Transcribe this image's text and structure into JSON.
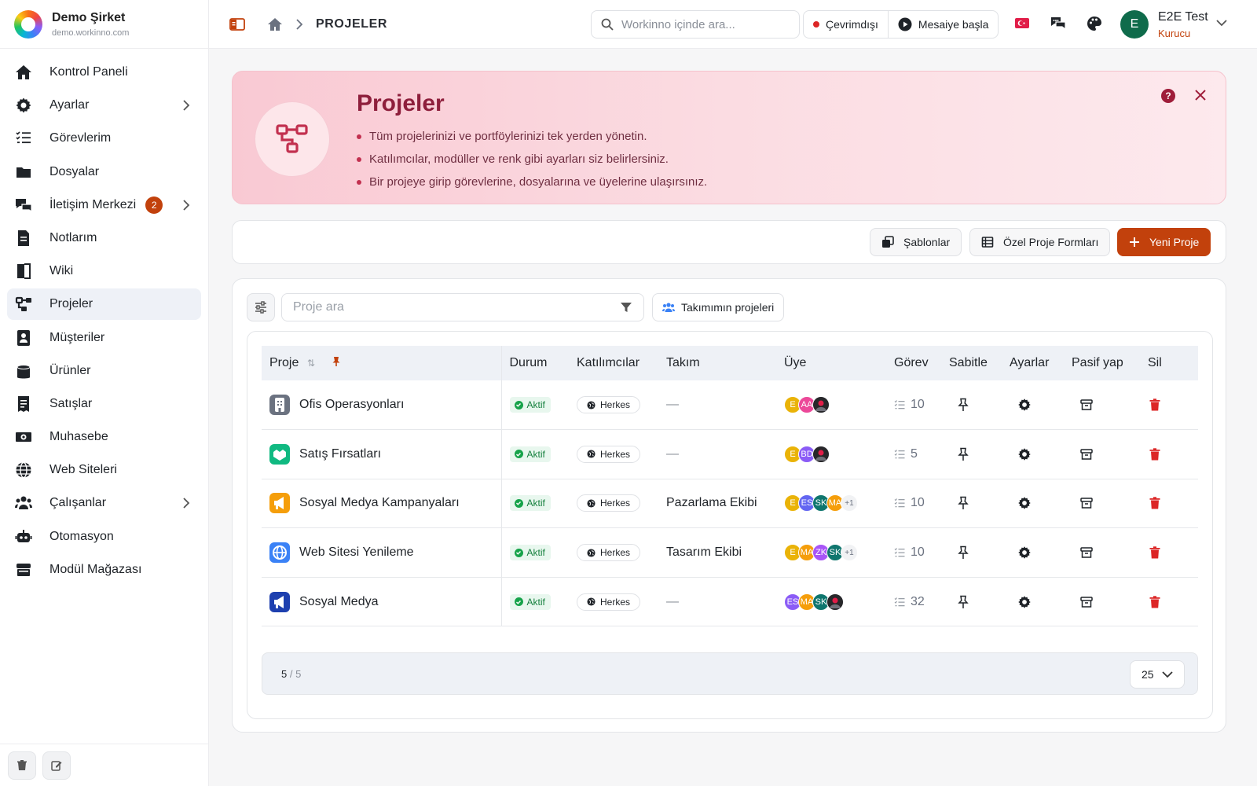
{
  "brand": {
    "name": "Demo Şirket",
    "domain": "demo.workinno.com"
  },
  "sidebar": {
    "items": [
      {
        "label": "Kontrol Paneli",
        "icon": "home-icon"
      },
      {
        "label": "Ayarlar",
        "icon": "gear-icon",
        "chevron": true
      },
      {
        "label": "Görevlerim",
        "icon": "tasks-icon"
      },
      {
        "label": "Dosyalar",
        "icon": "folder-icon"
      },
      {
        "label": "İletişim Merkezi",
        "icon": "chat-icon",
        "badge": "2",
        "chevron": true
      },
      {
        "label": "Notlarım",
        "icon": "notes-icon"
      },
      {
        "label": "Wiki",
        "icon": "book-icon"
      },
      {
        "label": "Projeler",
        "icon": "project-icon",
        "active": true
      },
      {
        "label": "Müşteriler",
        "icon": "contacts-icon"
      },
      {
        "label": "Ürünler",
        "icon": "box-icon"
      },
      {
        "label": "Satışlar",
        "icon": "receipt-icon"
      },
      {
        "label": "Muhasebe",
        "icon": "money-icon"
      },
      {
        "label": "Web Siteleri",
        "icon": "globe-icon"
      },
      {
        "label": "Çalışanlar",
        "icon": "users-icon",
        "chevron": true
      },
      {
        "label": "Otomasyon",
        "icon": "robot-icon"
      },
      {
        "label": "Modül Mağazası",
        "icon": "store-icon"
      }
    ]
  },
  "header": {
    "breadcrumb": "PROJELER",
    "search_placeholder": "Workinno içinde ara...",
    "status": "Çevrimdışı",
    "shift": "Mesaiye başla",
    "user": {
      "initial": "E",
      "name": "E2E Test",
      "role": "Kurucu"
    }
  },
  "banner": {
    "title": "Projeler",
    "bullets": [
      "Tüm projelerinizi ve portföylerinizi tek yerden yönetin.",
      "Katılımcılar, modüller ve renk gibi ayarları siz belirlersiniz.",
      "Bir projeye girip görevlerine, dosyalarına ve üyelerine ulaşırsınız."
    ],
    "help": "?"
  },
  "actions": {
    "templates": "Şablonlar",
    "custom_forms": "Özel Proje Formları",
    "new_project": "Yeni Proje"
  },
  "filters": {
    "search_placeholder": "Proje ara",
    "team_projects": "Takımımın projeleri"
  },
  "table": {
    "headers": {
      "proje": "Proje",
      "durum": "Durum",
      "katilimcilar": "Katılımcılar",
      "takim": "Takım",
      "uye": "Üye",
      "gorev": "Görev",
      "sabitle": "Sabitle",
      "ayarlar": "Ayarlar",
      "pasif": "Pasif yap",
      "sil": "Sil"
    },
    "rows": [
      {
        "name": "Ofis Operasyonları",
        "icon_color": "#6b7280",
        "status": "Aktif",
        "participants": "Herkes",
        "team": "—",
        "members": [
          {
            "i": "E",
            "c": "#eab308"
          },
          {
            "i": "AA",
            "c": "#ec4899"
          },
          {
            "i": "",
            "c": "#3f3f46"
          }
        ],
        "members_more": "",
        "tasks": "10"
      },
      {
        "name": "Satış Fırsatları",
        "icon_color": "#10b981",
        "status": "Aktif",
        "participants": "Herkes",
        "team": "—",
        "members": [
          {
            "i": "E",
            "c": "#eab308"
          },
          {
            "i": "BD",
            "c": "#8b5cf6"
          },
          {
            "i": "",
            "c": "#3f3f46"
          }
        ],
        "members_more": "",
        "tasks": "5"
      },
      {
        "name": "Sosyal Medya Kampanyaları",
        "icon_color": "#f59e0b",
        "status": "Aktif",
        "participants": "Herkes",
        "team": "Pazarlama Ekibi",
        "members": [
          {
            "i": "E",
            "c": "#eab308"
          },
          {
            "i": "ES",
            "c": "#6366f1"
          },
          {
            "i": "SK",
            "c": "#0f766e"
          },
          {
            "i": "MA",
            "c": "#f59e0b"
          }
        ],
        "members_more": "+1",
        "tasks": "10"
      },
      {
        "name": "Web Sitesi Yenileme",
        "icon_color": "#3b82f6",
        "status": "Aktif",
        "participants": "Herkes",
        "team": "Tasarım Ekibi",
        "members": [
          {
            "i": "E",
            "c": "#eab308"
          },
          {
            "i": "MA",
            "c": "#f59e0b"
          },
          {
            "i": "ZK",
            "c": "#a855f7"
          },
          {
            "i": "SK",
            "c": "#0f766e"
          }
        ],
        "members_more": "+1",
        "tasks": "10"
      },
      {
        "name": "Sosyal Medya",
        "icon_color": "#1e40af",
        "status": "Aktif",
        "participants": "Herkes",
        "team": "—",
        "members": [
          {
            "i": "ES",
            "c": "#8b5cf6"
          },
          {
            "i": "MA",
            "c": "#f59e0b"
          },
          {
            "i": "SK",
            "c": "#0f766e"
          },
          {
            "i": "",
            "c": "#3f3f46"
          }
        ],
        "members_more": "",
        "tasks": "32"
      }
    ]
  },
  "pagination": {
    "shown": "5",
    "sep": "/",
    "total": "5",
    "page_size": "25"
  },
  "colors": {
    "accent": "#c2410c",
    "banner_title": "#8e1f3c",
    "aktif": "#16a34a",
    "delete": "#dc2626"
  }
}
